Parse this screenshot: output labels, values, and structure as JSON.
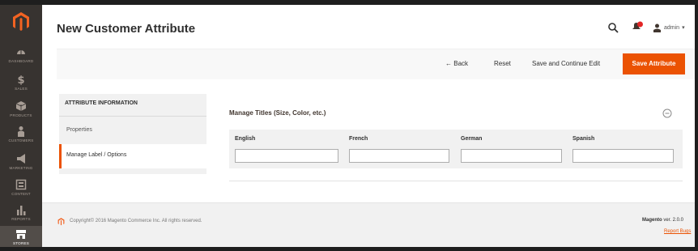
{
  "sidebar": {
    "items": [
      {
        "label": "Dashboard",
        "icon": "dashboard-icon"
      },
      {
        "label": "Sales",
        "icon": "dollar-icon"
      },
      {
        "label": "Products",
        "icon": "box-icon"
      },
      {
        "label": "Customers",
        "icon": "person-icon"
      },
      {
        "label": "Marketing",
        "icon": "megaphone-icon"
      },
      {
        "label": "Content",
        "icon": "layout-icon"
      },
      {
        "label": "Reports",
        "icon": "bar-chart-icon"
      },
      {
        "label": "Stores",
        "icon": "store-icon"
      }
    ],
    "active": "Stores"
  },
  "header": {
    "title": "New Customer Attribute",
    "user": "admin"
  },
  "actions": {
    "back": "Back",
    "reset": "Reset",
    "save_continue": "Save and Continue Edit",
    "save": "Save Attribute"
  },
  "tabs": {
    "heading": "ATTRIBUTE INFORMATION",
    "items": [
      "Properties",
      "Manage Label / Options"
    ],
    "active": "Manage Label / Options"
  },
  "section": {
    "title": "Manage Titles (Size, Color, etc.)",
    "columns": [
      "English",
      "French",
      "German",
      "Spanish"
    ],
    "values": [
      "",
      "",
      "",
      ""
    ]
  },
  "footer": {
    "copyright": "Copyright© 2016 Magento Commerce Inc. All rights reserved.",
    "brand": "Magento",
    "version": " ver. 2.0.0",
    "report": "Report Bugs"
  },
  "colors": {
    "accent": "#eb5202",
    "sidebar": "#373330"
  }
}
